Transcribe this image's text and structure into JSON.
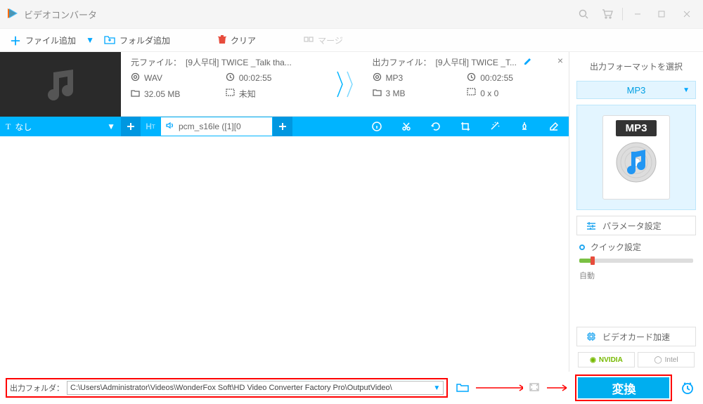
{
  "app": {
    "title": "ビデオコンバータ"
  },
  "toolbar": {
    "add_file": "ファイル追加",
    "add_folder": "フォルダ追加",
    "clear": "クリア",
    "merge": "マージ"
  },
  "item": {
    "source": {
      "label": "元ファイル：",
      "name": "[9人무대] TWICE _Talk tha...",
      "format": "WAV",
      "duration": "00:02:55",
      "size": "32.05 MB",
      "resolution": "未知"
    },
    "output": {
      "label": "出力ファイル：",
      "name": "[9人무대] TWICE _T...",
      "format": "MP3",
      "duration": "00:02:55",
      "size": "3 MB",
      "resolution": "0 x 0"
    },
    "subtitle_none": "なし",
    "audio_codec": "pcm_s16le ([1][0"
  },
  "sidebar": {
    "title": "出力フォーマットを選択",
    "format": "MP3",
    "format_badge": "MP3",
    "param_btn": "パラメータ設定",
    "quick": "クイック設定",
    "auto": "自動",
    "gpu_btn": "ビデオカード加速",
    "nvidia": "NVIDIA",
    "intel": "Intel"
  },
  "footer": {
    "out_label": "出力フォルダ：",
    "path": "C:\\Users\\Administrator\\Videos\\WonderFox Soft\\HD Video Converter Factory Pro\\OutputVideo\\",
    "convert": "変換"
  }
}
